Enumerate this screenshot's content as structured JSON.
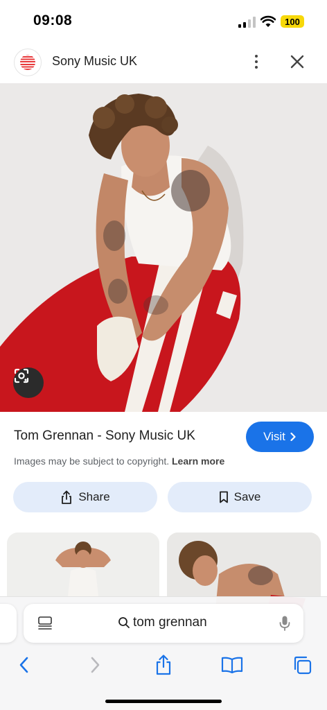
{
  "status": {
    "time": "09:08",
    "battery": "100",
    "signal_icon": "cellular-signal-icon",
    "wifi_icon": "wifi-icon"
  },
  "source": {
    "name": "Sony Music UK",
    "logo_icon": "sony-music-logo",
    "more_icon": "more-vert-icon",
    "close_icon": "close-icon"
  },
  "image": {
    "title": "Tom Grennan - Sony Music UK",
    "lens_icon": "google-lens-icon"
  },
  "visit": {
    "label": "Visit",
    "icon": "chevron-right-icon",
    "color": "#1a73e8"
  },
  "copyright": {
    "text": "Images may be subject to copyright.",
    "link": "Learn more"
  },
  "actions": {
    "share_label": "Share",
    "save_label": "Save",
    "share_icon": "share-icon",
    "save_icon": "bookmark-icon",
    "button_color": "#e3ecfa"
  },
  "search": {
    "query": "tom grennan",
    "search_icon": "search-icon",
    "mic_icon": "microphone-icon",
    "tabs_icon": "tab-overview-icon"
  },
  "nav": {
    "back_icon": "back-icon",
    "forward_icon": "forward-icon",
    "share_icon": "share-icon",
    "bookmarks_icon": "bookmarks-book-icon",
    "tabs_icon": "tabs-icon",
    "accent": "#1a73e8"
  }
}
